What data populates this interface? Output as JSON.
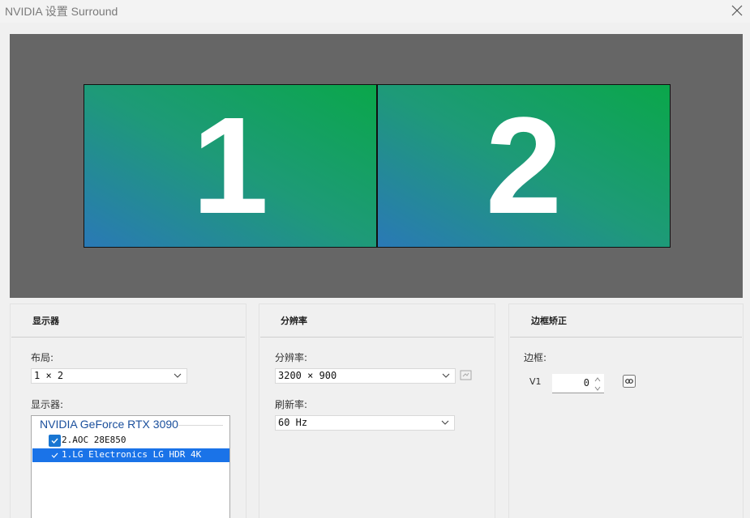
{
  "window": {
    "title": "NVIDIA 设置 Surround"
  },
  "preview": {
    "monitors": [
      {
        "label": "1"
      },
      {
        "label": "2"
      }
    ]
  },
  "display_panel": {
    "header": "显示器",
    "layout_label": "布局:",
    "layout_value": "1 × 2",
    "displays_label": "显示器:",
    "gpu": "NVIDIA GeForce RTX 3090",
    "displays": [
      {
        "label": "2.AOC 28E850",
        "checked": true,
        "selected": false
      },
      {
        "label": "1.LG Electronics LG HDR 4K",
        "checked": true,
        "selected": true
      }
    ]
  },
  "resolution_panel": {
    "header": "分辨率",
    "resolution_label": "分辨率:",
    "resolution_value": "3200 × 900",
    "refresh_label": "刷新率:",
    "refresh_value": "60 Hz"
  },
  "bezel_panel": {
    "header": "边框矫正",
    "bezel_label": "边框:",
    "v1_label": "V1",
    "v1_value": "0"
  },
  "colors": {
    "selection": "#1a73e8",
    "checkbox": "#1976d2",
    "gpu_text": "#1a4f9c",
    "preview_bg": "#666666"
  }
}
